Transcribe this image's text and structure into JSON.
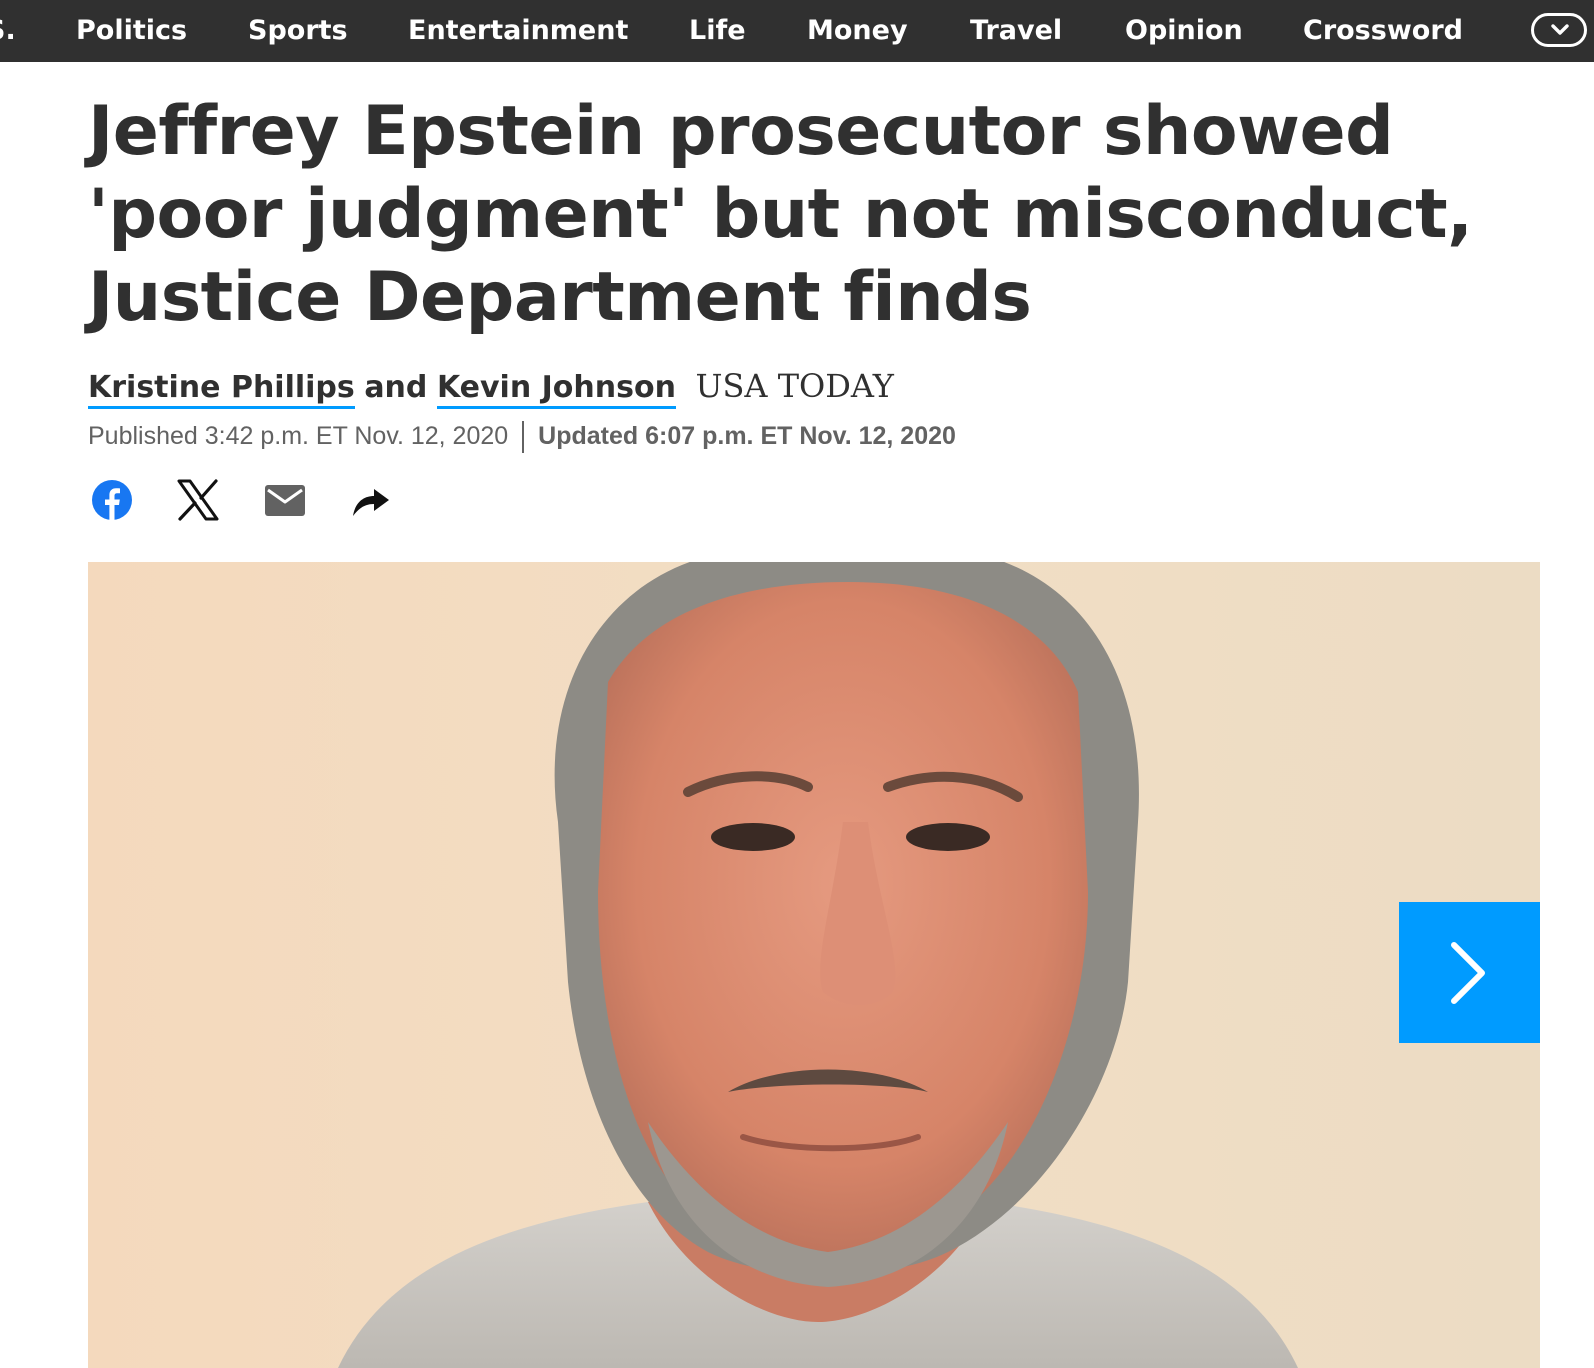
{
  "nav": {
    "items": [
      "S.",
      "Politics",
      "Sports",
      "Entertainment",
      "Life",
      "Money",
      "Travel",
      "Opinion",
      "Crossword"
    ],
    "more_icon": "chevron-down-icon"
  },
  "article": {
    "headline": "Jeffrey Epstein prosecutor showed 'poor judgment' but not misconduct, Justice Department finds",
    "authors": [
      "Kristine Phillips",
      "Kevin Johnson"
    ],
    "author_conjunction": "and",
    "outlet": "USA TODAY",
    "published": "Published 3:42 p.m. ET Nov. 12, 2020",
    "updated": "Updated 6:07 p.m. ET Nov. 12, 2020"
  },
  "share": {
    "icons": [
      "facebook-icon",
      "x-icon",
      "email-icon",
      "share-arrow-icon"
    ]
  },
  "gallery": {
    "next_icon": "chevron-right-icon"
  },
  "colors": {
    "nav_bg": "#303030",
    "accent": "#009bff",
    "text": "#303030",
    "meta_text": "#626262",
    "facebook": "#1877f2"
  }
}
